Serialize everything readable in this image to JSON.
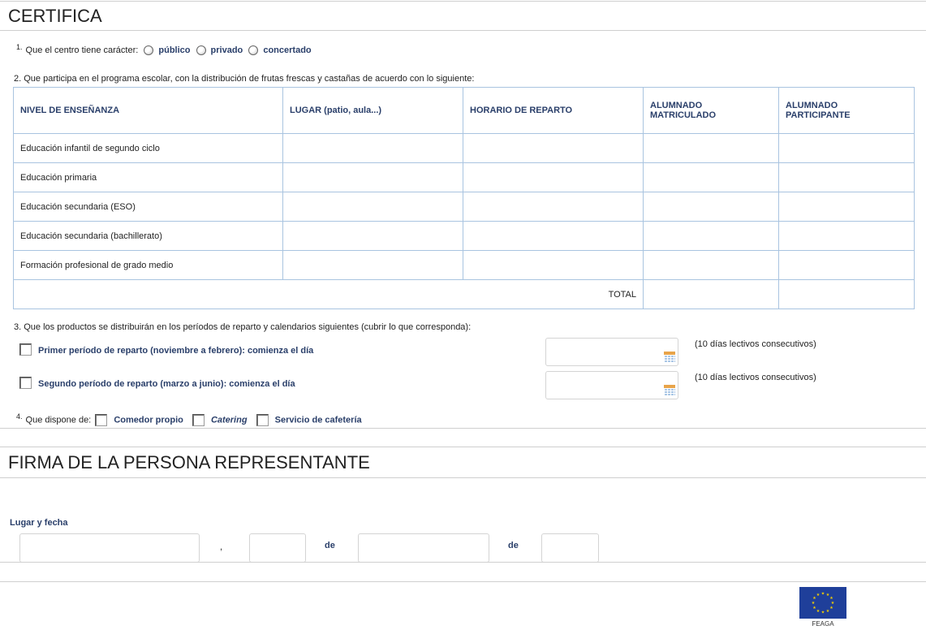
{
  "certifica": {
    "title": "CERTIFICA",
    "q1": {
      "num": "1.",
      "label": "Que el centro tiene carácter:",
      "options": [
        "público",
        "privado",
        "concertado"
      ]
    },
    "q2": {
      "label": "2.  Que participa en el programa escolar, con la distribución de frutas frescas y castañas de acuerdo con lo siguiente:",
      "headers": [
        "NIVEL DE ENSEÑANZA",
        "LUGAR (patio, aula...)",
        "HORARIO DE REPARTO",
        "ALUMNADO MATRICULADO",
        "ALUMNADO PARTICIPANTE"
      ],
      "rows": [
        "Educación infantil de segundo ciclo",
        "Educación primaria",
        "Educación secundaria (ESO)",
        "Educación secundaria (bachillerato)",
        "Formación profesional de grado medio"
      ],
      "total_label": "TOTAL"
    },
    "q3": {
      "label": "3.  Que los productos se distribuirán en los períodos de reparto y calendarios siguientes (cubrir lo que corresponda):",
      "periods": [
        {
          "label": "Primer período de reparto (noviembre a febrero): comienza el día",
          "note": "(10 días lectivos consecutivos)"
        },
        {
          "label": "Segundo período de reparto (marzo a junio): comienza el día",
          "note": "(10 días lectivos consecutivos)"
        }
      ]
    },
    "q4": {
      "num": "4.",
      "label": "Que dispone de:",
      "options": [
        "Comedor propio",
        "Catering",
        "Servicio de cafetería"
      ]
    }
  },
  "firma": {
    "title": "FIRMA DE LA PERSONA REPRESENTANTE",
    "lugar_fecha_label": "Lugar y fecha",
    "comma": ",",
    "de1": "de",
    "de2": "de"
  },
  "footer": {
    "logo_caption": "FEAGA",
    "flag_color": "#1f3f9a"
  }
}
